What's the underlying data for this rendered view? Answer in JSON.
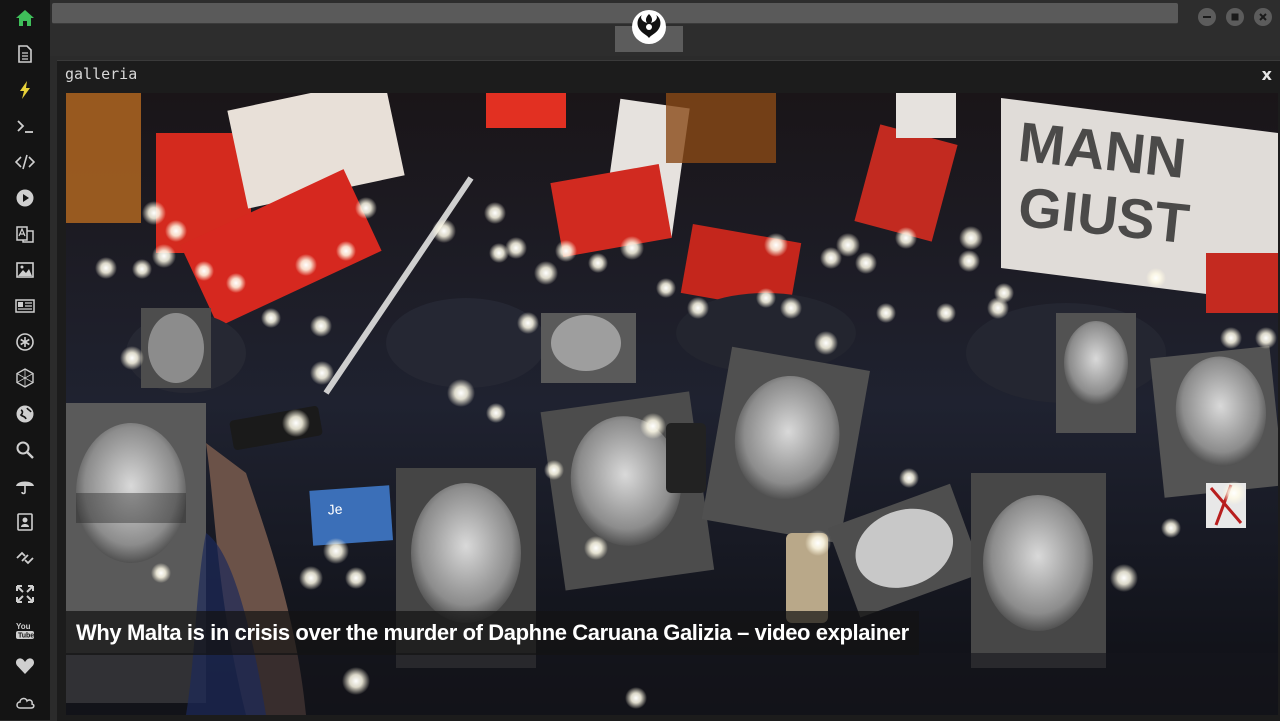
{
  "sidebar": {
    "items": [
      {
        "icon": "home-icon",
        "active": true
      },
      {
        "icon": "document-icon"
      },
      {
        "icon": "lightning-icon",
        "highlight": true
      },
      {
        "icon": "terminal-icon"
      },
      {
        "icon": "code-icon"
      },
      {
        "icon": "play-icon"
      },
      {
        "icon": "translate-icon"
      },
      {
        "icon": "image-icon"
      },
      {
        "icon": "news-icon"
      },
      {
        "icon": "asterisk-circle-icon"
      },
      {
        "icon": "hexagon-icon"
      },
      {
        "icon": "globe-icon"
      },
      {
        "icon": "search-icon"
      },
      {
        "icon": "umbrella-icon"
      },
      {
        "icon": "contact-icon"
      },
      {
        "icon": "link-icon"
      },
      {
        "icon": "expand-icon"
      },
      {
        "icon": "youtube-icon"
      },
      {
        "icon": "heart-icon"
      },
      {
        "icon": "cloud-icon"
      }
    ]
  },
  "window": {
    "buttons": [
      "minimize-icon",
      "maximize-icon",
      "close-icon"
    ]
  },
  "panel": {
    "title": "galleria",
    "close_label": "x"
  },
  "gallery": {
    "caption": "Why Malta is in crisis over the murder of Daphne Caruana Galizia – video explainer"
  },
  "colors": {
    "accent_green": "#3fbf5a",
    "accent_yellow": "#e8d23a",
    "icon_gray": "#cfcfcf"
  }
}
